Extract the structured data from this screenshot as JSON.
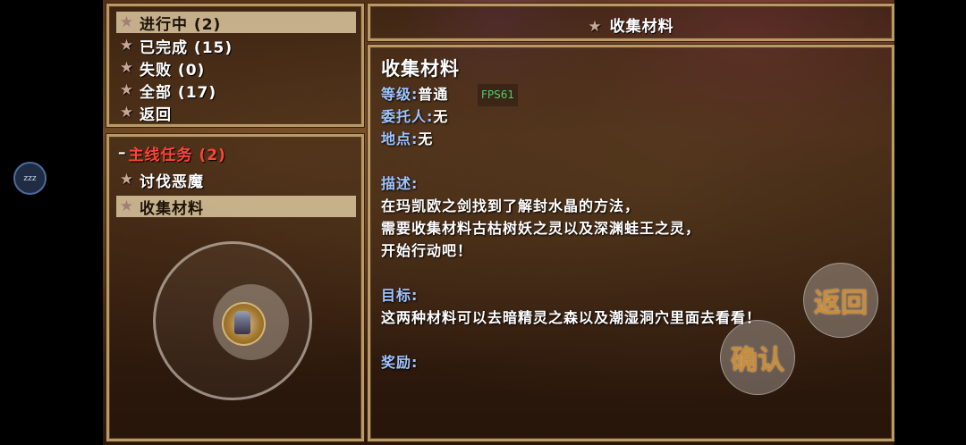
{
  "floating_button": {
    "label": "zzz"
  },
  "status_menu": {
    "items": [
      {
        "label": "进行中 (2)",
        "selected": true
      },
      {
        "label": "已完成 (15)"
      },
      {
        "label": "失败 (0)"
      },
      {
        "label": "全部 (17)"
      },
      {
        "label": "返回"
      }
    ]
  },
  "quest_list": {
    "header": "主线任务 (2)",
    "items": [
      {
        "label": "讨伐恶魔"
      },
      {
        "label": "收集材料",
        "selected": true
      }
    ]
  },
  "header": {
    "title": "收集材料"
  },
  "detail": {
    "title": "收集材料",
    "fps": "FPS61",
    "level_label": "等级:",
    "level_value": "普通",
    "client_label": "委托人:",
    "client_value": "无",
    "location_label": "地点:",
    "location_value": "无",
    "description_label": "描述:",
    "description_lines": [
      "在玛凯欧之剑找到了解封水晶的方法，",
      "需要收集材料古枯树妖之灵以及深渊蛙王之灵，",
      "开始行动吧！"
    ],
    "objective_label": "目标:",
    "objective_value": "这两种材料可以去暗精灵之森以及潮湿洞穴里面去看看！",
    "reward_label": "奖励:"
  },
  "buttons": {
    "back": "返回",
    "confirm": "确认"
  },
  "colors": {
    "quest_header": "#ff4438",
    "label_blue": "#9ec4ff",
    "fps_green": "#46d06a"
  }
}
